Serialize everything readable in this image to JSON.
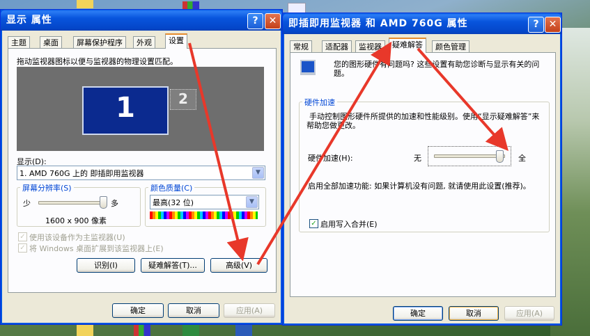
{
  "display_props": {
    "title": "显示 属性",
    "tabs": [
      "主题",
      "桌面",
      "屏幕保护程序",
      "外观",
      "设置"
    ],
    "instruction": "拖动监视器图标以便与监视器的物理设置匹配。",
    "monitor_1": "1",
    "monitor_2": "2",
    "display_label": "显示(D):",
    "display_value": "1. AMD 760G 上的 即插即用监视器",
    "resolution_legend": "屏幕分辨率(S)",
    "res_less": "少",
    "res_more": "多",
    "res_value": "1600 x 900 像素",
    "resolution_level": 1.0,
    "color_legend": "颜色质量(C)",
    "color_value": "最高(32 位)",
    "primary_checkbox": "使用该设备作为主监视器(U)",
    "extend_checkbox": "将 Windows 桌面扩展到该监视器上(E)",
    "btn_identify": "识别(I)",
    "btn_troubleshoot": "疑难解答(T)...",
    "btn_advanced": "高级(V)",
    "btn_ok": "确定",
    "btn_cancel": "取消",
    "btn_apply": "应用(A)"
  },
  "monitor_props": {
    "title": "即插即用监视器 和 AMD 760G 属性",
    "tabs": [
      "常规",
      "适配器",
      "监视器",
      "疑难解答",
      "颜色管理"
    ],
    "intro": "您的图形硬件有问题吗? 这些设置有助您诊断与显示有关的问题。",
    "hw_legend": "硬件加速",
    "hw_desc": "手动控制图形硬件所提供的加速和性能级别。使用“显示疑难解答”来帮助您做更改。",
    "hw_label": "硬件加速(H):",
    "hw_none": "无",
    "hw_full": "全",
    "hw_level": 0.95,
    "hw_status": "启用全部加速功能: 如果计算机没有问题, 就请使用此设置(推荐)。",
    "write_combine": "启用写入合并(E)",
    "btn_ok": "确定",
    "btn_cancel": "取消",
    "btn_apply": "应用(A)"
  },
  "help_glyph": "?",
  "close_glyph": "✕",
  "checkmark_glyph": "✓",
  "dropdown_glyph": "▼",
  "colors": {
    "title_blue": "#0855dd",
    "annotation_arrow": "#e8382a",
    "monitor_selected": "#0b2a8f",
    "tab_highlight": "#e68b2c"
  }
}
